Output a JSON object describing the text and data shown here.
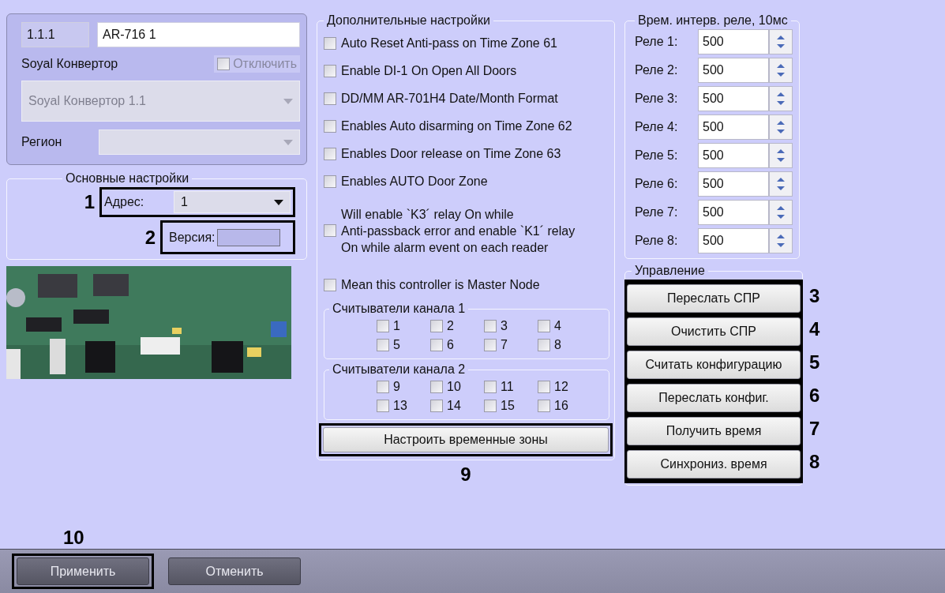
{
  "header": {
    "number": "1.1.1",
    "name": "AR-716 1"
  },
  "converter": {
    "label": "Soyal Конвертор",
    "disable": {
      "label": "Отключить",
      "checked": false,
      "disabled": true
    },
    "select": {
      "value": "Soyal Конвертор 1.1",
      "disabled": true
    }
  },
  "region": {
    "label": "Регион"
  },
  "basic": {
    "title": "Основные настройки",
    "address": {
      "label": "Адрес:",
      "value": "1",
      "callout": "1"
    },
    "version": {
      "label": "Версия:",
      "callout": "2"
    }
  },
  "extra": {
    "title": "Дополнительные настройки",
    "options": [
      {
        "label": "Auto Reset Anti-pass on Time Zone 61",
        "checked": false
      },
      {
        "label": "Enable DI-1 On Open All Doors",
        "checked": false
      },
      {
        "label": "DD/MM AR-701H4 Date/Month Format",
        "checked": false
      },
      {
        "label": "Enables Auto disarming on Time Zone 62",
        "checked": false
      },
      {
        "label": "Enables Door release on Time Zone 63",
        "checked": false
      },
      {
        "label": "Enables AUTO Door  Zone",
        "checked": false
      },
      {
        "label": "Will enable `K3´ relay On while\nAnti-passback error and enable `K1´ relay\nOn while alarm event on each reader",
        "checked": false
      }
    ],
    "master": {
      "label": "Mean this controller is Master Node",
      "checked": false
    },
    "readers": [
      {
        "title": "Считыватели канала 1",
        "items": [
          {
            "label": "1",
            "checked": false
          },
          {
            "label": "2",
            "checked": false
          },
          {
            "label": "3",
            "checked": false
          },
          {
            "label": "4",
            "checked": false
          },
          {
            "label": "5",
            "checked": false
          },
          {
            "label": "6",
            "checked": false
          },
          {
            "label": "7",
            "checked": false
          },
          {
            "label": "8",
            "checked": false
          }
        ]
      },
      {
        "title": "Считыватели канала 2",
        "items": [
          {
            "label": "9",
            "checked": false
          },
          {
            "label": "10",
            "checked": false
          },
          {
            "label": "11",
            "checked": false
          },
          {
            "label": "12",
            "checked": false
          },
          {
            "label": "13",
            "checked": false
          },
          {
            "label": "14",
            "checked": false
          },
          {
            "label": "15",
            "checked": false
          },
          {
            "label": "16",
            "checked": false
          }
        ]
      }
    ],
    "timezones_button": {
      "label": "Настроить временные зоны",
      "callout": "9"
    }
  },
  "relays": {
    "title": "Врем. интерв. реле, 10мс",
    "items": [
      {
        "label": "Реле 1:",
        "value": "500"
      },
      {
        "label": "Реле 2:",
        "value": "500"
      },
      {
        "label": "Реле 3:",
        "value": "500"
      },
      {
        "label": "Реле 4:",
        "value": "500"
      },
      {
        "label": "Реле 5:",
        "value": "500"
      },
      {
        "label": "Реле 6:",
        "value": "500"
      },
      {
        "label": "Реле 7:",
        "value": "500"
      },
      {
        "label": "Реле 8:",
        "value": "500"
      }
    ]
  },
  "control": {
    "title": "Управление",
    "buttons": [
      {
        "label": "Переслать СПР",
        "callout": "3"
      },
      {
        "label": "Очистить СПР",
        "callout": "4"
      },
      {
        "label": "Считать конфигурацию",
        "callout": "5"
      },
      {
        "label": "Переслать конфиг.",
        "callout": "6"
      },
      {
        "label": "Получить время",
        "callout": "7"
      },
      {
        "label": "Синхрониз. время",
        "callout": "8"
      }
    ]
  },
  "footer": {
    "callout": "10",
    "buttons": [
      {
        "label": "Применить",
        "highlighted": true
      },
      {
        "label": "Отменить",
        "highlighted": false
      }
    ]
  }
}
